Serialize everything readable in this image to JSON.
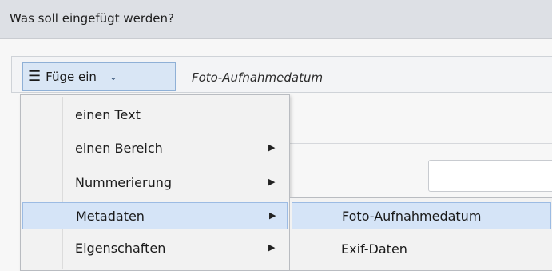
{
  "window": {
    "title": "Was soll eingefügt werden?"
  },
  "toolbar": {
    "insert_button_label": "Füge ein",
    "menu_icon": "hamburger-icon",
    "chevron_icon": "chevron-down-icon",
    "current_value": "Foto-Aufnahmedatum"
  },
  "menu": {
    "items": [
      {
        "label": "einen Text",
        "has_submenu": false
      },
      {
        "label": "einen Bereich",
        "has_submenu": true
      },
      {
        "label": "Nummerierung",
        "has_submenu": true
      },
      {
        "label": "Metadaten",
        "has_submenu": true,
        "highlighted": true
      },
      {
        "label": "Eigenschaften",
        "has_submenu": true
      }
    ]
  },
  "submenu": {
    "items": [
      {
        "label": "Foto-Aufnahmedatum",
        "highlighted": true
      },
      {
        "label": "Exif-Daten"
      }
    ]
  },
  "colors": {
    "highlight_bg": "#d5e4f7",
    "highlight_border": "#9cbbe3",
    "titlebar_bg": "#dde0e5"
  }
}
